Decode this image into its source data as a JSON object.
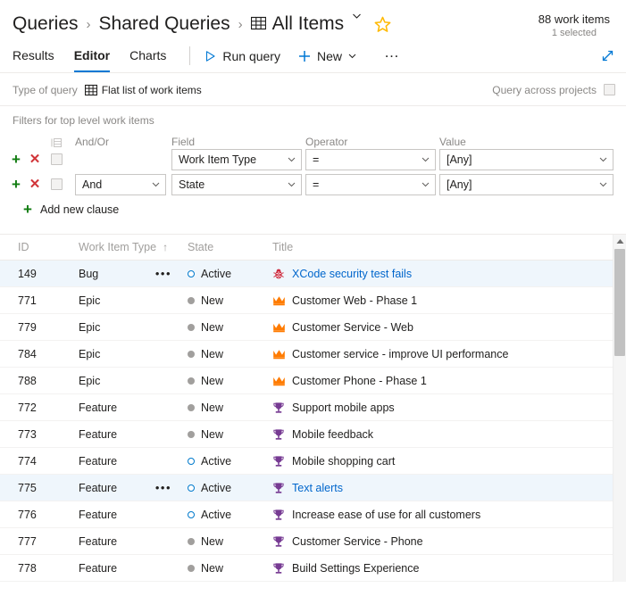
{
  "breadcrumb": {
    "root": "Queries",
    "folder": "Shared Queries",
    "current": "All Items",
    "grid_icon": "grid-view-icon",
    "chevron_icon": "chevron-down-icon",
    "favorite_icon": "star-icon",
    "separator": "›"
  },
  "header": {
    "work_items_count": "88 work items",
    "selected_count": "1 selected"
  },
  "toolbar": {
    "tabs": [
      {
        "label": "Results",
        "active": false
      },
      {
        "label": "Editor",
        "active": true
      },
      {
        "label": "Charts",
        "active": false
      }
    ],
    "run_query": "Run query",
    "run_icon": "play-triangle-icon",
    "new_label": "New",
    "new_icon": "plus-icon",
    "new_chevron": "chevron-down-icon",
    "more_label": "…",
    "more_icon": "ellipsis-icon",
    "expand_icon": "expand-diagonal-icon"
  },
  "query_type": {
    "label": "Type of query",
    "value": "Flat list of work items",
    "icon": "flat-list-grid-icon",
    "across_projects_label": "Query across projects",
    "across_projects_checked": false
  },
  "filters": {
    "section_title": "Filters for top level work items",
    "columns": {
      "group": "group-icon",
      "andor": "And/Or",
      "field": "Field",
      "operator": "Operator",
      "value": "Value"
    },
    "add_icon": "plus-icon",
    "remove_icon": "close-x-icon",
    "add_clause_label": "Add new clause",
    "rows": [
      {
        "andor": "",
        "field": "Work Item Type",
        "operator": "=",
        "value": "[Any]",
        "checked": false
      },
      {
        "andor": "And",
        "field": "State",
        "operator": "=",
        "value": "[Any]",
        "checked": false
      }
    ]
  },
  "grid": {
    "columns": [
      "ID",
      "Work Item Type",
      "State",
      "Title"
    ],
    "sort_column": "Work Item Type",
    "sort_direction": "↑",
    "rows": [
      {
        "id": "149",
        "type": "Bug",
        "state": "Active",
        "title": "XCode security test fails",
        "icon": "bug-icon",
        "selected": true,
        "dots": true,
        "link": true
      },
      {
        "id": "771",
        "type": "Epic",
        "state": "New",
        "title": "Customer Web - Phase 1",
        "icon": "crown-icon",
        "selected": false,
        "dots": false,
        "link": false
      },
      {
        "id": "779",
        "type": "Epic",
        "state": "New",
        "title": "Customer Service - Web",
        "icon": "crown-icon",
        "selected": false,
        "dots": false,
        "link": false
      },
      {
        "id": "784",
        "type": "Epic",
        "state": "New",
        "title": "Customer service - improve UI performance",
        "icon": "crown-icon",
        "selected": false,
        "dots": false,
        "link": false
      },
      {
        "id": "788",
        "type": "Epic",
        "state": "New",
        "title": "Customer Phone - Phase 1",
        "icon": "crown-icon",
        "selected": false,
        "dots": false,
        "link": false
      },
      {
        "id": "772",
        "type": "Feature",
        "state": "New",
        "title": "Support mobile apps",
        "icon": "trophy-icon",
        "selected": false,
        "dots": false,
        "link": false
      },
      {
        "id": "773",
        "type": "Feature",
        "state": "New",
        "title": "Mobile feedback",
        "icon": "trophy-icon",
        "selected": false,
        "dots": false,
        "link": false
      },
      {
        "id": "774",
        "type": "Feature",
        "state": "Active",
        "title": "Mobile shopping cart",
        "icon": "trophy-icon",
        "selected": false,
        "dots": false,
        "link": false
      },
      {
        "id": "775",
        "type": "Feature",
        "state": "Active",
        "title": "Text alerts",
        "icon": "trophy-icon",
        "selected": true,
        "dots": true,
        "link": true
      },
      {
        "id": "776",
        "type": "Feature",
        "state": "Active",
        "title": "Increase ease of use for all customers",
        "icon": "trophy-icon",
        "selected": false,
        "dots": false,
        "link": false
      },
      {
        "id": "777",
        "type": "Feature",
        "state": "New",
        "title": "Customer Service - Phone",
        "icon": "trophy-icon",
        "selected": false,
        "dots": false,
        "link": false
      },
      {
        "id": "778",
        "type": "Feature",
        "state": "New",
        "title": "Build Settings Experience",
        "icon": "trophy-icon",
        "selected": false,
        "dots": false,
        "link": false
      }
    ]
  },
  "colors": {
    "accent": "#0078d4",
    "link": "#0066cc",
    "bug": "#cc293d",
    "epic": "#ff7b00",
    "feature": "#773b93",
    "add": "#107c10",
    "remove": "#d13438",
    "star": "#ffb900",
    "state_new": "#a19f9d",
    "state_active": "#007acc",
    "selected_row": "#eff6fc"
  }
}
